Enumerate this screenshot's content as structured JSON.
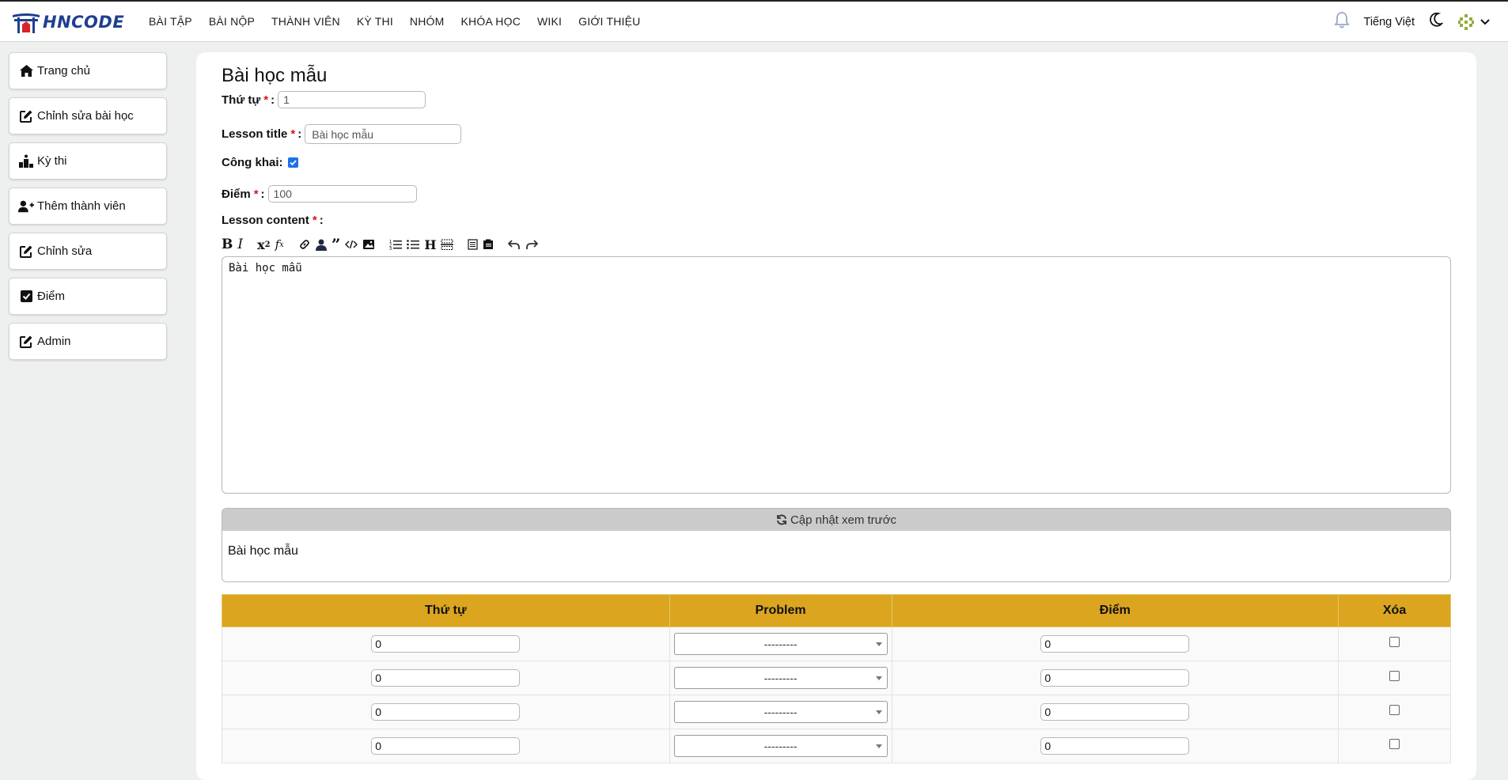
{
  "brand": {
    "logo_text": "HNCODE"
  },
  "nav": [
    "BÀI TẬP",
    "BÀI NỘP",
    "THÀNH VIÊN",
    "KỲ THI",
    "NHÓM",
    "KHÓA HỌC",
    "WIKI",
    "GIỚI THIỆU"
  ],
  "topbar": {
    "language": "Tiếng Việt"
  },
  "sidebar": [
    {
      "label": "Trang chủ",
      "icon": "home-icon"
    },
    {
      "label": "Chỉnh sửa bài học",
      "icon": "edit-icon"
    },
    {
      "label": "Kỳ thi",
      "icon": "podium-icon"
    },
    {
      "label": "Thêm thành viên",
      "icon": "user-plus-icon"
    },
    {
      "label": "Chỉnh sửa",
      "icon": "edit-icon"
    },
    {
      "label": "Điểm",
      "icon": "checkbox-icon"
    },
    {
      "label": "Admin",
      "icon": "edit-icon"
    }
  ],
  "form": {
    "title": "Bài học mẫu",
    "order": {
      "label": "Thứ tự",
      "value": "1"
    },
    "lesson_title": {
      "label": "Lesson title",
      "value": "Bài học mẫu"
    },
    "public": {
      "label": "Công khai:",
      "checked": true
    },
    "points": {
      "label": "Điểm",
      "value": "100"
    },
    "content": {
      "label": "Lesson content",
      "value": "Bài học mẫu"
    },
    "required_mark": "*",
    "sep": ":"
  },
  "preview": {
    "button_label": "Cập nhật xem trước",
    "text": "Bài học mẫu"
  },
  "problems_table": {
    "headers": [
      "Thứ tự",
      "Problem",
      "Điểm",
      "Xóa"
    ],
    "rows": [
      {
        "order": "0",
        "problem": "---------",
        "points": "0",
        "delete": false
      },
      {
        "order": "0",
        "problem": "---------",
        "points": "0",
        "delete": false
      },
      {
        "order": "0",
        "problem": "---------",
        "points": "0",
        "delete": false
      },
      {
        "order": "0",
        "problem": "---------",
        "points": "0",
        "delete": false
      }
    ]
  },
  "colors": {
    "table_header": "#dba520",
    "accent_blue": "#1a73e8",
    "required": "#e01010"
  }
}
